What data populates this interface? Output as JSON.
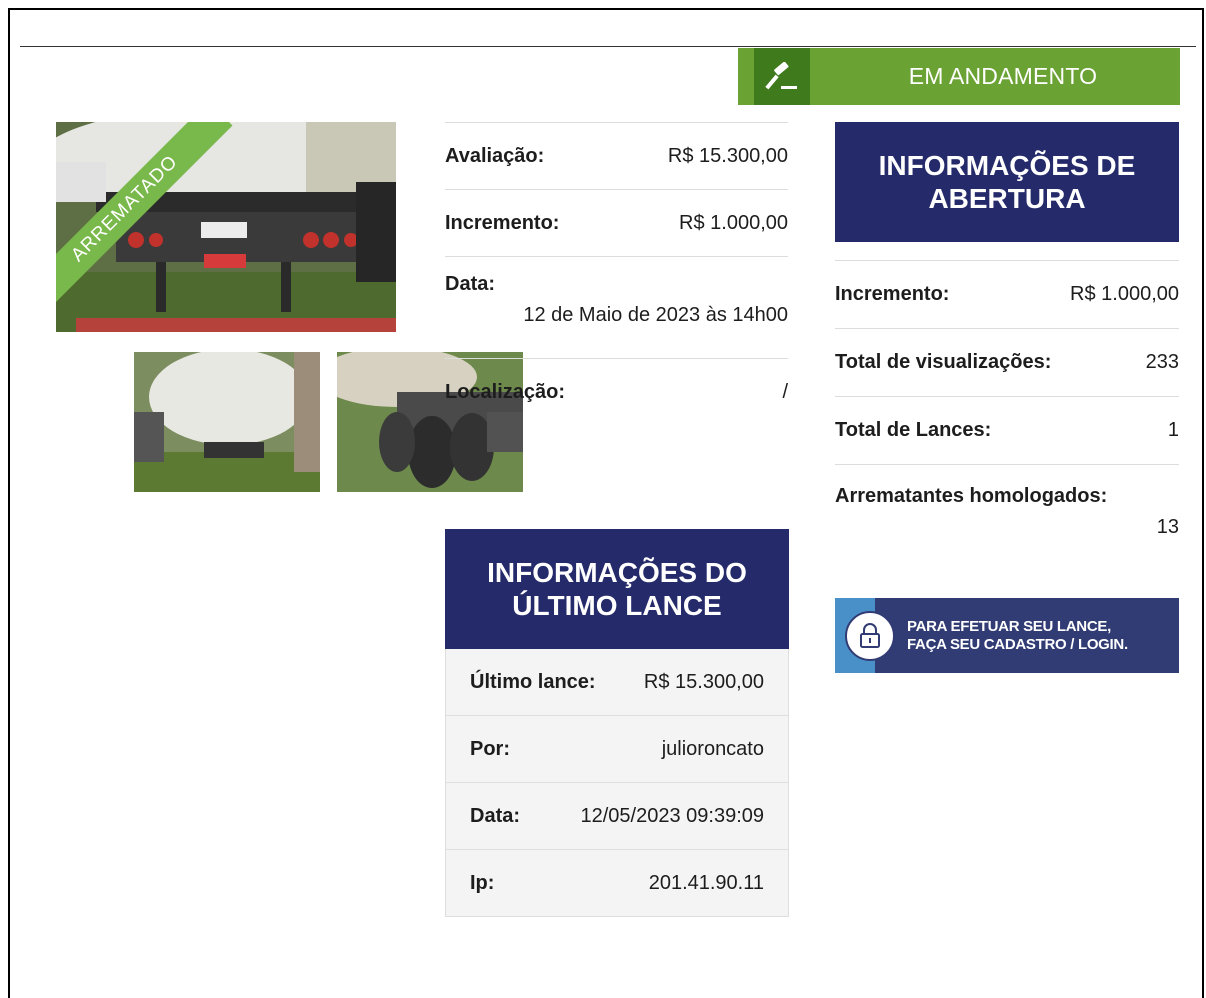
{
  "status": {
    "label": "EM ANDAMENTO",
    "icon": "gavel-icon",
    "color": "#6aa234"
  },
  "lot": {
    "ribbon": "ARREMATADO",
    "details": {
      "evaluation_label": "Avaliação:",
      "evaluation_value": "R$ 15.300,00",
      "increment_label": "Incremento:",
      "increment_value": "R$ 1.000,00",
      "date_label": "Data:",
      "date_value": "12 de Maio de 2023 às 14h00",
      "location_label": "Localização:",
      "location_value": "/"
    }
  },
  "last_bid": {
    "title": "INFORMAÇÕES DO ÚLTIMO LANCE",
    "rows": [
      {
        "label": "Último lance:",
        "value": "R$ 15.300,00"
      },
      {
        "label": "Por:",
        "value": "julioroncato"
      },
      {
        "label": "Data:",
        "value": "12/05/2023 09:39:09"
      },
      {
        "label": "Ip:",
        "value": "201.41.90.11"
      }
    ]
  },
  "opening": {
    "title": "INFORMAÇÕES DE ABERTURA",
    "increment_label": "Incremento:",
    "increment_value": "R$ 1.000,00",
    "views_label": "Total de visualizações:",
    "views_value": "233",
    "bids_label": "Total de Lances:",
    "bids_value": "1",
    "approved_label": "Arrematantes homologados:",
    "approved_value": "13"
  },
  "login_banner": {
    "line1": "PARA EFETUAR SEU LANCE,",
    "line2": "FAÇA SEU CADASTRO / LOGIN.",
    "icon": "lock-icon"
  },
  "colors": {
    "navy": "#252a6a",
    "green": "#6aa234",
    "ribbon": "#79b84a"
  }
}
